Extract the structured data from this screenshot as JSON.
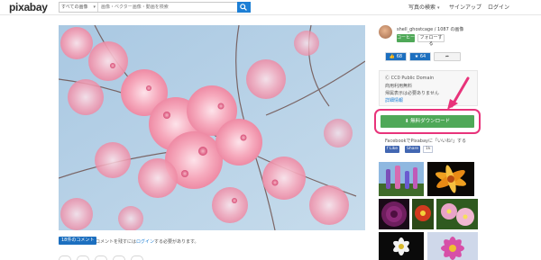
{
  "header": {
    "logo": "pixabay",
    "search_category": "すべての画像",
    "search_placeholder": "画像・ベクター画像・動画を検索",
    "nav": {
      "photos_search": "写真の検索",
      "signup": "サインアップ",
      "login": "ログイン"
    }
  },
  "uploader": {
    "name_line": "shell_ghostcage / 1087 の画像",
    "follow_label": "コーヒー",
    "subscribe_label": "フォローする"
  },
  "stats": {
    "likes": "68",
    "favorites": "64",
    "share_icon": "share-arrow-icon"
  },
  "license": {
    "title": "CC0 Public Domain",
    "line1": "商用利用無料",
    "line2": "帰属表示は必要ありません",
    "details_link": "詳細情報"
  },
  "download": {
    "label": "無料ダウンロード",
    "highlight_color": "#e8337a",
    "button_color": "#4fa858"
  },
  "facebook": {
    "prompt": "FacebookでPixabayに「いいね!」する",
    "like_label": "Like",
    "share_label": "Share",
    "count": "1k"
  },
  "comments": {
    "badge": "18件のコメント",
    "text_before": "コメントを残すには",
    "login_link": "ログイン",
    "text_after": "する必要があります。"
  },
  "colors": {
    "accent_blue": "#1d7fd5",
    "sky": "#b4cfe4",
    "blossom": "#f4a7b9"
  }
}
